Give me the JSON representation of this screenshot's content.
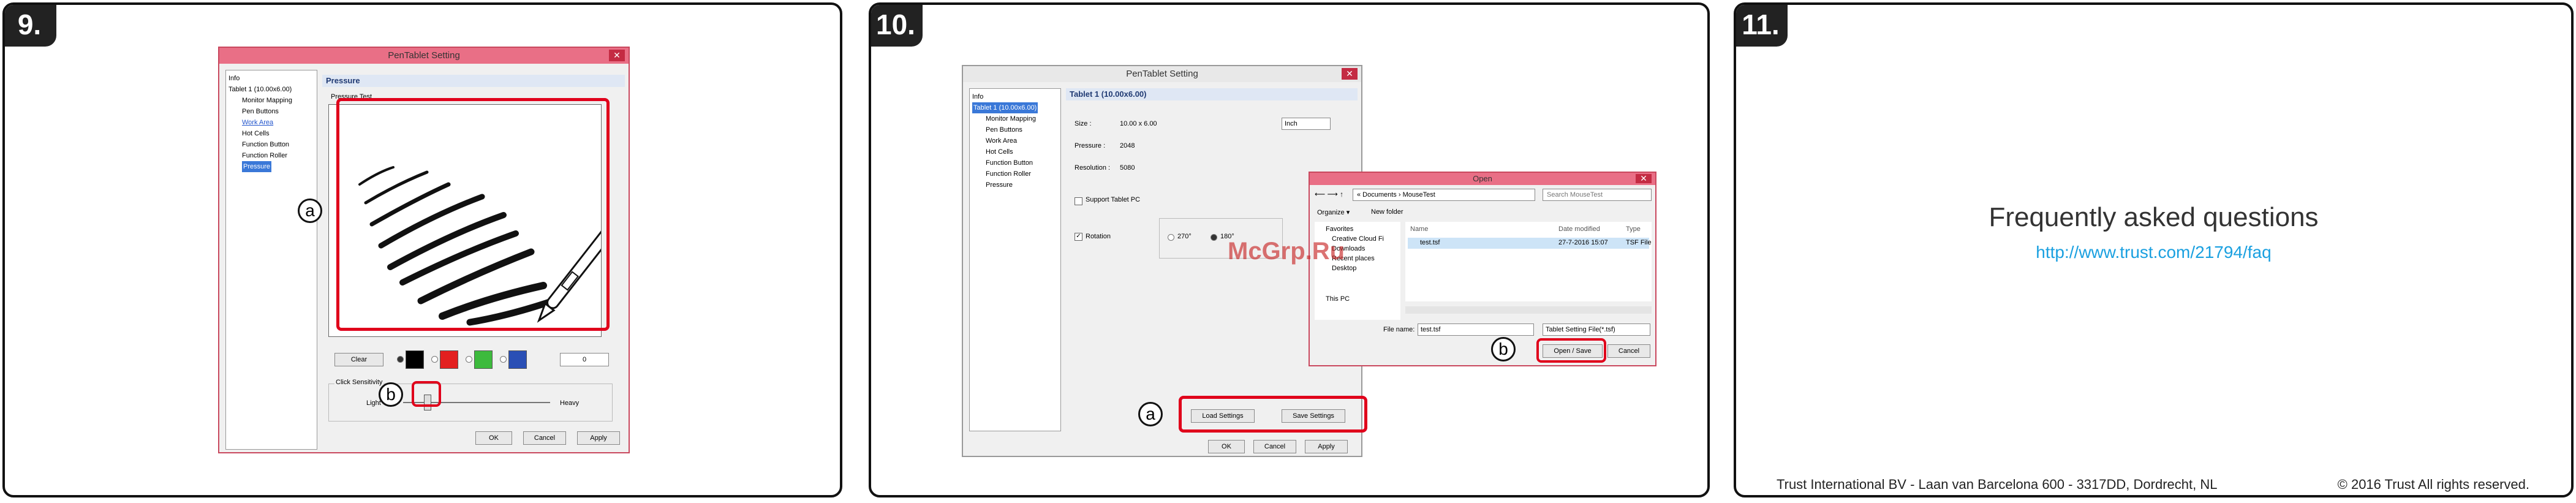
{
  "steps": [
    "9.",
    "10.",
    "11."
  ],
  "panel9": {
    "window_title": "PenTablet Setting",
    "close_glyph": "✕",
    "tree": {
      "info": "Info",
      "tablet": "Tablet 1 (10.00x6.00)",
      "items": [
        "Monitor Mapping",
        "Pen Buttons",
        "Work Area",
        "Hot Cells",
        "Function Button",
        "Function Roller",
        "Pressure"
      ]
    },
    "section_header": "Pressure",
    "test_area_label": "Pressure Test",
    "clear_button": "Clear",
    "pressure_value": "0",
    "swatch_colors": [
      "#000000",
      "#e32020",
      "#3dba3d",
      "#2a4fb5"
    ],
    "click_sensitivity_label": "Click Sensitivity",
    "light_label": "Light",
    "heavy_label": "Heavy",
    "ok_button": "OK",
    "cancel_button": "Cancel",
    "apply_button": "Apply",
    "callout_a": "a",
    "callout_b": "b"
  },
  "panel10": {
    "window_title": "PenTablet Setting",
    "close_glyph": "✕",
    "tree": {
      "info": "Info",
      "tablet": "Tablet 1 (10.00x6.00)",
      "items": [
        "Monitor Mapping",
        "Pen Buttons",
        "Work Area",
        "Hot Cells",
        "Function Button",
        "Function Roller",
        "Pressure"
      ]
    },
    "section_header": "Tablet 1 (10.00x6.00)",
    "size_label": "Size :",
    "size_value": "10.00 x 6.00",
    "unit_value": "Inch",
    "pressure_label": "Pressure :",
    "pressure_value": "2048",
    "resolution_label": "Resolution :",
    "resolution_value": "5080",
    "support_tablet_pc": "Support Tablet PC",
    "rotation_label": "Rotation",
    "rotation_options": [
      "270°",
      "180°"
    ],
    "load_settings": "Load Settings",
    "save_settings": "Save Settings",
    "ok_button": "OK",
    "cancel_button": "Cancel",
    "apply_button": "Apply",
    "callout_a": "a",
    "callout_b": "b",
    "watermark": "McGrp.Ru",
    "open_dialog": {
      "title": "Open",
      "path": "« Documents › MouseTest",
      "search_placeholder": "Search MouseTest",
      "organize": "Organize ▾",
      "new_folder": "New folder",
      "nav_items": [
        "Favorites",
        "Creative Cloud Fi",
        "Downloads",
        "Recent places",
        "Desktop",
        "This PC"
      ],
      "col_name": "Name",
      "col_date": "Date modified",
      "col_type": "Type",
      "file_name": "test.tsf",
      "file_date": "27-7-2016 15:07",
      "file_type": "TSF File",
      "filename_label": "File name:",
      "filename_value": "test.tsf",
      "filter_value": "Tablet Setting File(*.tsf)",
      "open_save": "Open / Save",
      "cancel": "Cancel"
    }
  },
  "panel11": {
    "faq_title": "Frequently asked questions",
    "faq_link": "http://www.trust.com/21794/faq",
    "footer_left": "Trust International BV - Laan van Barcelona 600 - 3317DD, Dordrecht, NL",
    "footer_right": "© 2016 Trust All rights reserved."
  }
}
